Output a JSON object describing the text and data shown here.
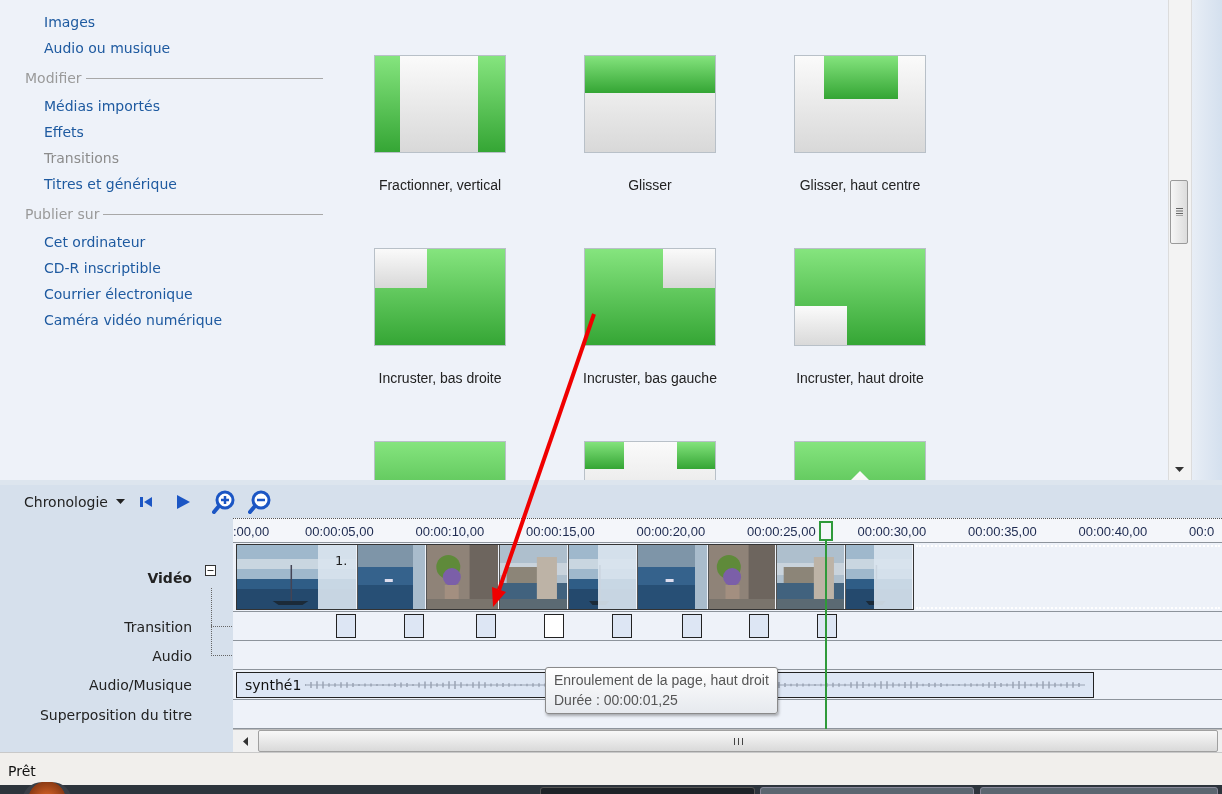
{
  "sidebar": {
    "sections": [
      {
        "items": [
          {
            "label": "Images",
            "disabled": false
          },
          {
            "label": "Audio ou musique",
            "disabled": false
          }
        ]
      },
      {
        "heading": "Modifier",
        "items": [
          {
            "label": "Médias importés",
            "disabled": false
          },
          {
            "label": "Effets",
            "disabled": false
          },
          {
            "label": "Transitions",
            "disabled": true
          },
          {
            "label": "Titres et générique",
            "disabled": false
          }
        ]
      },
      {
        "heading": "Publier sur",
        "items": [
          {
            "label": "Cet ordinateur",
            "disabled": false
          },
          {
            "label": "CD-R inscriptible",
            "disabled": false
          },
          {
            "label": "Courrier électronique",
            "disabled": false
          },
          {
            "label": "Caméra vidéo numérique",
            "disabled": false
          }
        ]
      }
    ]
  },
  "transitions": [
    {
      "label": "Fractionner, vertical",
      "kind": "split-vertical"
    },
    {
      "label": "Glisser",
      "kind": "slide"
    },
    {
      "label": "Glisser, haut centre",
      "kind": "slide-top-center"
    },
    {
      "label": "Incruster, bas droite",
      "kind": "inset-bottom-right"
    },
    {
      "label": "Incruster, bas gauche",
      "kind": "inset-bottom-left"
    },
    {
      "label": "Incruster, haut droite",
      "kind": "inset-top-right"
    },
    {
      "kind": "wipe"
    },
    {
      "kind": "split-center"
    },
    {
      "kind": "chevron"
    }
  ],
  "timeline": {
    "view_menu": "Chronologie",
    "ruler": [
      ":00,00",
      "00:00:05,00",
      "00:00:10,00",
      "00:00:15,00",
      "00:00:20,00",
      "00:00:25,00",
      "00:00:30,00",
      "00:00:35,00",
      "00:00:40,00",
      "00:0"
    ],
    "tracks": [
      {
        "kind": "video",
        "label": "Vidéo",
        "expanded": true
      },
      {
        "kind": "transition",
        "label": "Transition"
      },
      {
        "kind": "audio",
        "label": "Audio"
      },
      {
        "kind": "music",
        "label": "Audio/Musique"
      },
      {
        "kind": "title",
        "label": "Superposition du titre"
      }
    ],
    "clips": [
      {
        "kind": "picture",
        "caption": "1."
      },
      {
        "kind": "picture"
      },
      {
        "kind": "picture"
      },
      {
        "kind": "picture"
      },
      {
        "kind": "picture"
      },
      {
        "kind": "picture"
      },
      {
        "kind": "picture"
      },
      {
        "kind": "picture"
      },
      {
        "kind": "picture"
      }
    ],
    "transition_markers": [
      {
        "selected": false
      },
      {
        "selected": false
      },
      {
        "selected": false
      },
      {
        "selected": true
      },
      {
        "selected": false
      },
      {
        "selected": false
      },
      {
        "selected": false
      },
      {
        "selected": false
      }
    ],
    "music_clip": {
      "label": "synthé1"
    },
    "tooltip": {
      "title": "Enroulement de la page, haut droit",
      "text": "Durée : 00:00:01,25"
    }
  },
  "status_bar": "Prêt"
}
